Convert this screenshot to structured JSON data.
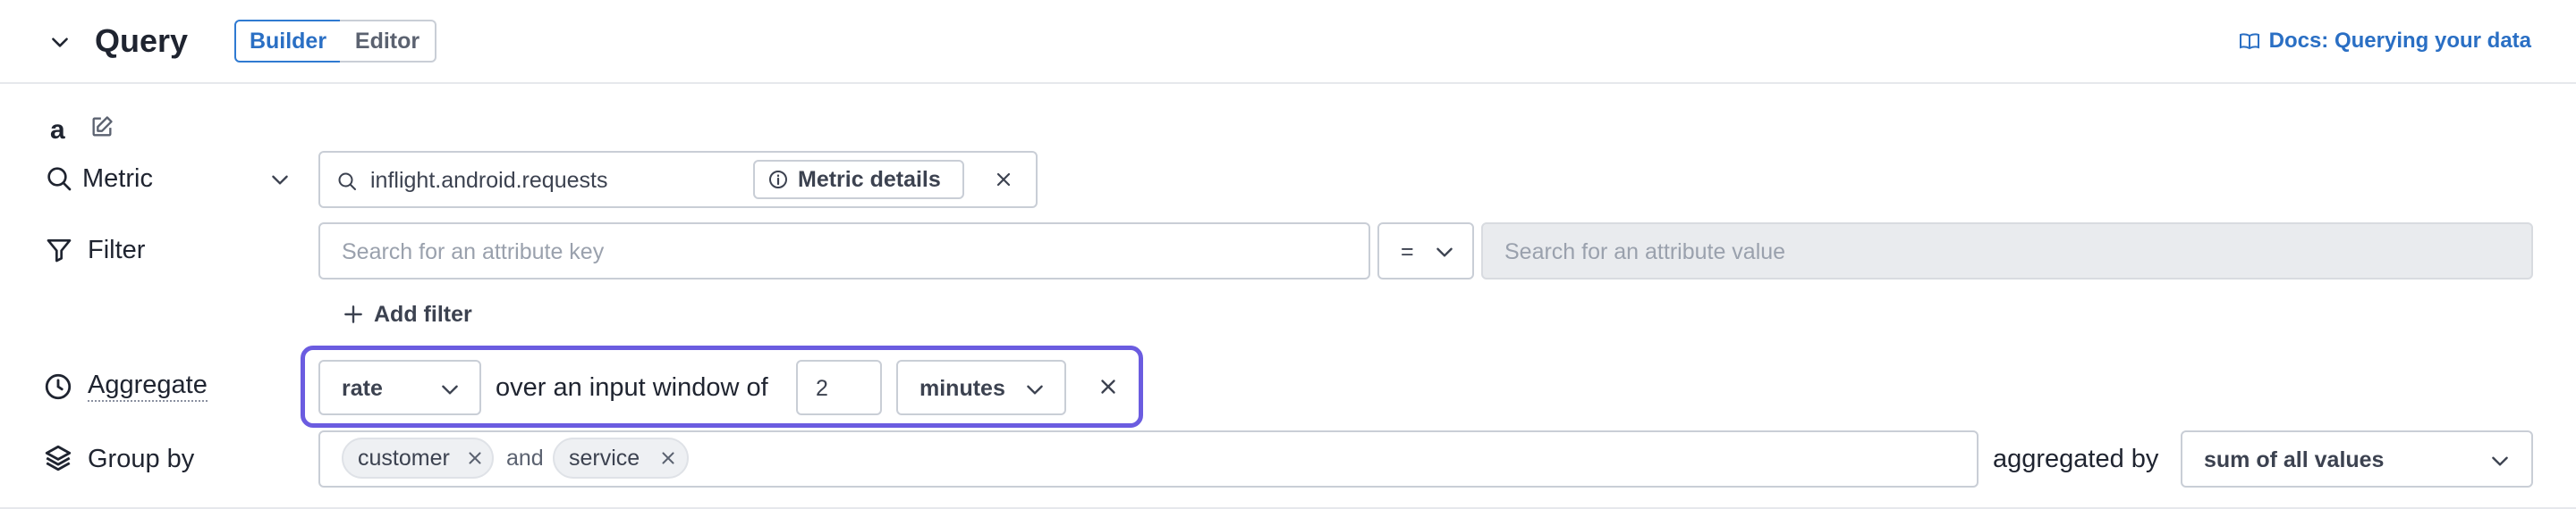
{
  "header": {
    "title": "Query",
    "tabs": {
      "builder": "Builder",
      "editor": "Editor"
    },
    "docs_link": "Docs: Querying your data"
  },
  "query": {
    "name": "a",
    "metric": {
      "label": "Metric",
      "value": "inflight.android.requests",
      "details_button": "Metric details"
    },
    "filter": {
      "label": "Filter",
      "key_placeholder": "Search for an attribute key",
      "operator": "=",
      "value_placeholder": "Search for an attribute value",
      "add_filter": "Add filter"
    },
    "aggregate": {
      "label": "Aggregate",
      "function": "rate",
      "window_text": "over an input window of",
      "window_value": "2",
      "window_unit": "minutes"
    },
    "group_by": {
      "label": "Group by",
      "tags": [
        "customer",
        "service"
      ],
      "joiner": "and",
      "aggregated_by_label": "aggregated by",
      "aggregated_by_value": "sum of all values"
    }
  },
  "colors": {
    "accent": "#2a6fc4",
    "highlight": "#6b5ce0"
  }
}
